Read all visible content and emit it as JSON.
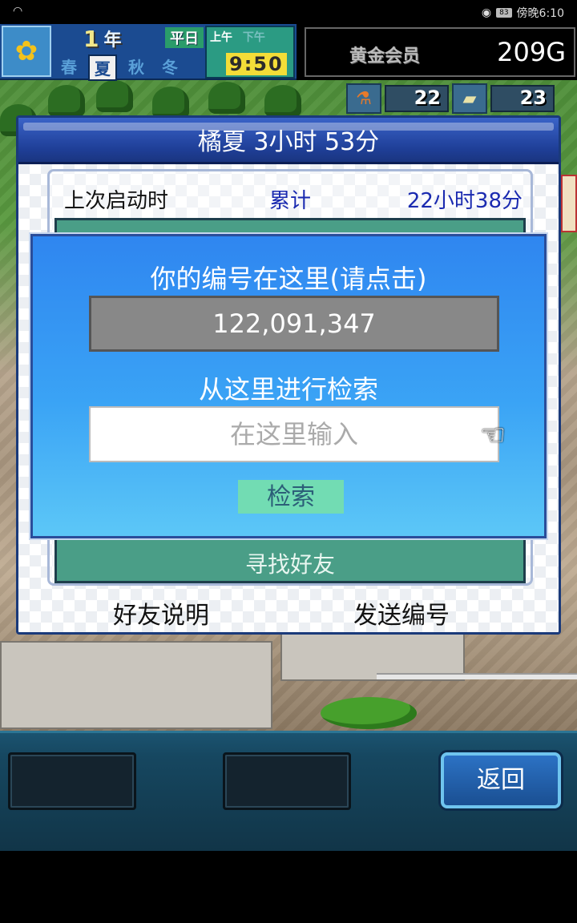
{
  "status_bar": {
    "wifi_icon": "wifi-icon",
    "eye_icon": "eye-icon",
    "battery": "83",
    "time": "傍晚6:10"
  },
  "hud": {
    "year_number": "1",
    "year_unit": "年",
    "day_type": "平日",
    "seasons": [
      "春",
      "夏",
      "秋",
      "冬"
    ],
    "active_season_index": 1,
    "am_label": "上午",
    "pm_label": "下午",
    "clock": "9:50",
    "membership_label": "黄金会员",
    "gold": "209G",
    "resources": [
      {
        "icon": "flask-icon",
        "value": "22"
      },
      {
        "icon": "ticket-icon",
        "value": "23"
      }
    ]
  },
  "friend_panel": {
    "title": "橘夏  3小时 53分",
    "last_launch_label": "上次启动时",
    "total_label": "累计",
    "total_value": "22小时38分",
    "find_friends_label": "寻找好友",
    "friend_help_label": "好友说明",
    "send_id_label": "发送编号"
  },
  "search_dialog": {
    "title": "你的编号在这里(请点击)",
    "user_id": "122,091,347",
    "search_subtitle": "从这里进行检索",
    "input_placeholder": "在这里输入",
    "search_button": "检索"
  },
  "bottom_bar": {
    "back_label": "返回"
  }
}
